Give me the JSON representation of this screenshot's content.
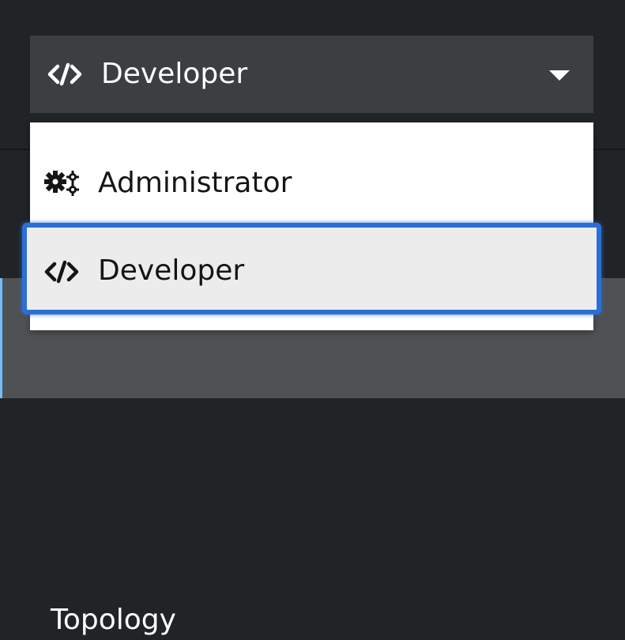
{
  "perspective_switcher": {
    "selected_label": "Developer",
    "selected_icon": "code-icon",
    "options": [
      {
        "label": "Administrator",
        "icon": "cogs-icon"
      },
      {
        "label": "Developer",
        "icon": "code-icon",
        "focused": true
      }
    ]
  },
  "nav": {
    "active_item_label": "Topology"
  },
  "colors": {
    "nav_background": "#212427",
    "toggle_background": "#3c3f42",
    "menu_background": "#ffffff",
    "focus_ring": "#2b6fd6",
    "active_indicator": "#73bcf7"
  }
}
